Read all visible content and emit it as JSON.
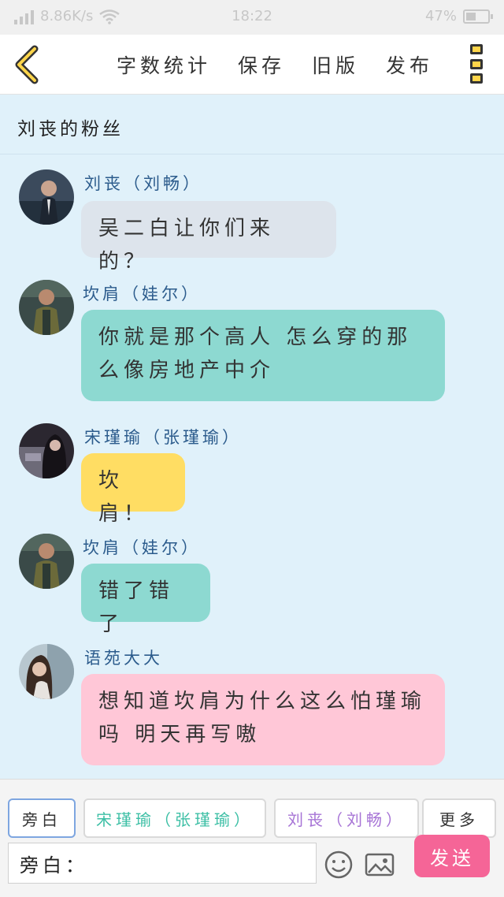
{
  "status_bar": {
    "speed": "8.86K/s",
    "time": "18:22",
    "battery_text": "47%",
    "battery_level": 0.47
  },
  "nav": {
    "back_icon": "chevron-left-icon",
    "actions": [
      "字数统计",
      "保存",
      "旧版",
      "发布"
    ],
    "menu_icon": "more-vertical-icon"
  },
  "chat_title": "刘丧的粉丝",
  "messages": [
    {
      "name": "刘丧（刘畅）",
      "text": "吴二白让你们来的？",
      "bubble_color": "#dde4ec"
    },
    {
      "name": "坎肩（娃尔）",
      "text": "你就是那个高人 怎么穿的那么像房地产中介",
      "bubble_color": "#8dd9d1"
    },
    {
      "name": "宋瑾瑜（张瑾瑜）",
      "text": "坎肩！",
      "bubble_color": "#ffdd63"
    },
    {
      "name": "坎肩（娃尔）",
      "text": "错了错了",
      "bubble_color": "#8dd9d1"
    },
    {
      "name": "语苑大大",
      "text": "想知道坎肩为什么这么怕瑾瑜吗 明天再写嗷",
      "bubble_color": "#ffc7d7"
    }
  ],
  "bottom": {
    "role_chips": [
      "旁白",
      "宋瑾瑜（张瑾瑜）",
      "刘丧（刘畅）",
      "更多"
    ],
    "input_value": "旁白：",
    "emoji_icon": "smiley-icon",
    "image_icon": "image-icon",
    "send_label": "发送"
  },
  "colors": {
    "background": "#e0f1fa",
    "name_color": "#2b5b8c",
    "chip_narration_border": "#7ea6e0",
    "chip_song_text": "#3cbfa5",
    "chip_liu_text": "#a774d6",
    "send_button": "#f56597",
    "menu_fill": "#ffd54a"
  }
}
